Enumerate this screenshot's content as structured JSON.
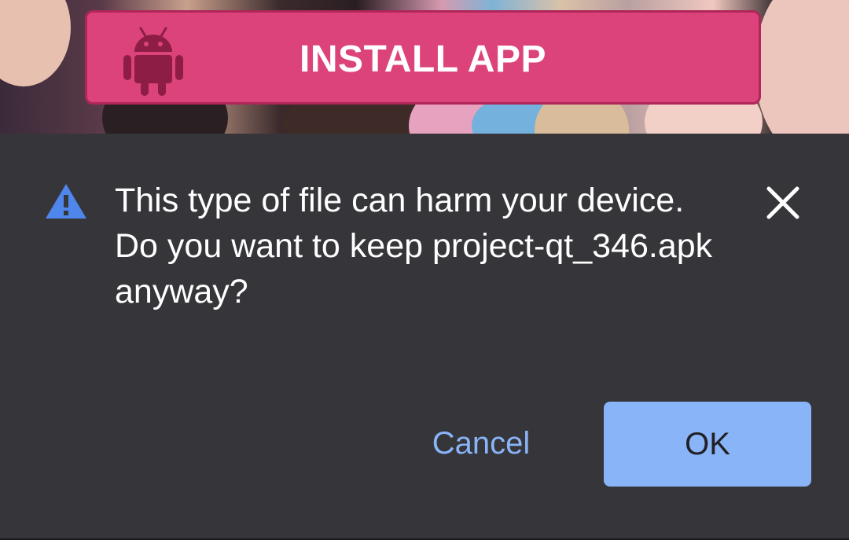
{
  "banner": {
    "label": "INSTALL APP",
    "icon": "android-icon",
    "color": "#dc437b"
  },
  "dialog": {
    "warning_icon": "warning-icon",
    "message": "This type of file can harm your device. Do you want to keep project-qt_346.apk anyway?",
    "close_icon": "close-icon",
    "cancel_label": "Cancel",
    "ok_label": "OK",
    "background": "#35353a",
    "accent": "#8ab4f8"
  }
}
